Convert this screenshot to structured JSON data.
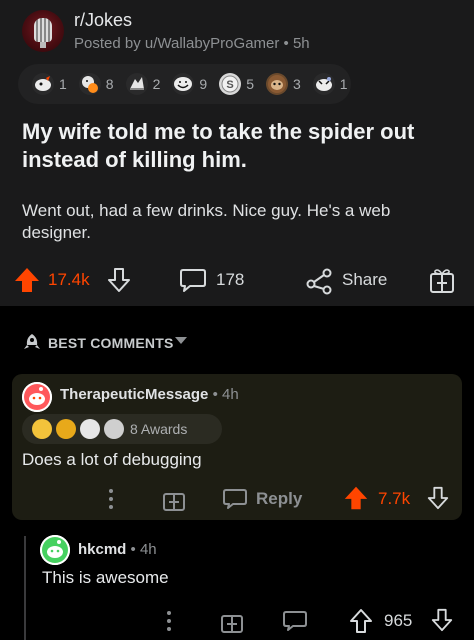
{
  "post": {
    "subreddit": "r/Jokes",
    "posted_by": "Posted by u/WallabyProGamer • 5h",
    "awards": [
      {
        "icon": "rocket-like-award-icon",
        "count": "1",
        "color": "#e8e8e8"
      },
      {
        "icon": "hugz-award-icon",
        "count": "8",
        "color": "#f7c34a"
      },
      {
        "icon": "bravo-award-icon",
        "count": "2",
        "color": "#e8e8e8"
      },
      {
        "icon": "laughing-face-award-icon",
        "count": "9",
        "color": "#e8e8e8"
      },
      {
        "icon": "silver-award-icon",
        "count": "5",
        "color": "#dcdcdc"
      },
      {
        "icon": "sloth-award-icon",
        "count": "3",
        "color": "#c0844a"
      },
      {
        "icon": "tearing-up-award-icon",
        "count": "1",
        "color": "#e8e8e8"
      }
    ],
    "title": "My wife told me to take the spider out instead of killing him.",
    "body": "Went out, had a few drinks. Nice guy. He's a web designer.",
    "upvotes": "17.4k",
    "comments": "178",
    "share_label": "Share"
  },
  "sort": {
    "label": "BEST COMMENTS"
  },
  "comments": [
    {
      "user": "TherapeuticMessage",
      "time": "• 4h",
      "awards_label": "8 Awards",
      "text": "Does a lot of debugging",
      "reply_label": "Reply",
      "score": "7.7k"
    },
    {
      "user": "hkcmd",
      "time": "• 4h",
      "text": "This is awesome",
      "score": "965"
    }
  ],
  "colors": {
    "upvote": "#ff4500",
    "background": "#1a1a1b",
    "highlight_comment": "#1d1d13"
  }
}
